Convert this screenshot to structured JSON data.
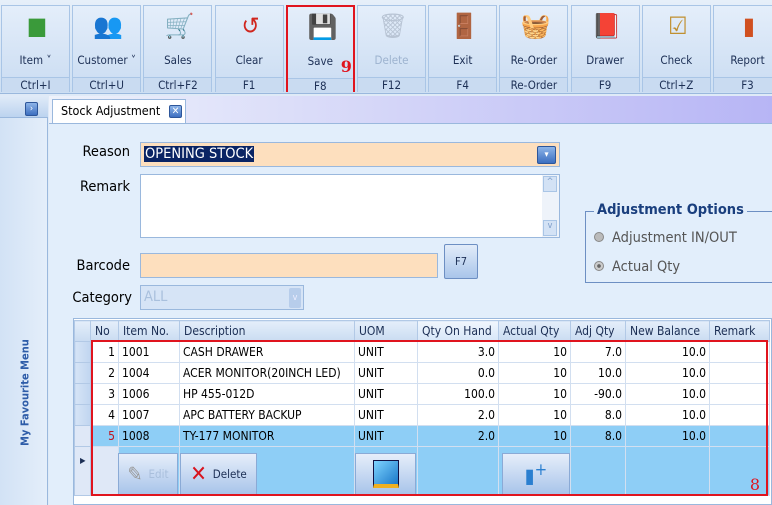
{
  "toolbar": {
    "buttons": [
      {
        "label": "Item",
        "shortcut": "Ctrl+I",
        "icon": "cubes-icon",
        "dropdown": true
      },
      {
        "label": "Customer",
        "shortcut": "Ctrl+U",
        "icon": "people-icon",
        "dropdown": true
      },
      {
        "label": "Sales",
        "shortcut": "Ctrl+F2",
        "icon": "cart-icon"
      },
      {
        "label": "Clear",
        "shortcut": "F1",
        "icon": "clear-icon"
      },
      {
        "label": "Save",
        "shortcut": "F8",
        "icon": "floppy-icon",
        "highlight_number": "9"
      },
      {
        "label": "Delete",
        "shortcut": "F12",
        "icon": "trash-icon",
        "disabled": true
      },
      {
        "label": "Exit",
        "shortcut": "F4",
        "icon": "exit-door-icon"
      },
      {
        "label": "Re-Order",
        "shortcut": "Re-Order",
        "icon": "basket-icon"
      },
      {
        "label": "Drawer",
        "shortcut": "F9",
        "icon": "drawer-icon"
      },
      {
        "label": "Check",
        "shortcut": "Ctrl+Z",
        "icon": "checklist-icon"
      },
      {
        "label": "Report",
        "shortcut": "F3",
        "icon": "bar-chart-icon"
      }
    ]
  },
  "sidebar": {
    "title": "My Favourite Menu"
  },
  "tab": {
    "label": "Stock Adjustment"
  },
  "form": {
    "reason_label": "Reason",
    "reason_value": "OPENING STOCK",
    "remark_label": "Remark",
    "remark_value": "",
    "barcode_label": "Barcode",
    "barcode_value": "",
    "barcode_button": "F7",
    "category_label": "Category",
    "category_value": "ALL"
  },
  "options": {
    "title": "Adjustment Options",
    "items": [
      "Adjustment IN/OUT",
      "Actual Qty"
    ],
    "selected": "Actual Qty"
  },
  "grid": {
    "columns": [
      "No",
      "Item No.",
      "Description",
      "UOM",
      "Qty On Hand",
      "Actual Qty",
      "Adj Qty",
      "New Balance",
      "Remark"
    ],
    "rows": [
      [
        "1",
        "1001",
        "CASH DRAWER",
        "UNIT",
        "3.0",
        "10",
        "7.0",
        "10.0",
        ""
      ],
      [
        "2",
        "1004",
        "ACER MONITOR(20INCH LED)",
        "UNIT",
        "0.0",
        "10",
        "10.0",
        "10.0",
        ""
      ],
      [
        "3",
        "1006",
        "HP 455-012D",
        "UNIT",
        "100.0",
        "10",
        "-90.0",
        "10.0",
        ""
      ],
      [
        "4",
        "1007",
        "APC BATTERY BACKUP",
        "UNIT",
        "2.0",
        "10",
        "8.0",
        "10.0",
        ""
      ],
      [
        "5",
        "1008",
        "TY-177 MONITOR",
        "UNIT",
        "2.0",
        "10",
        "8.0",
        "10.0",
        ""
      ]
    ],
    "edit_label": "Edit",
    "delete_label": "Delete",
    "highlight_number": "8"
  }
}
